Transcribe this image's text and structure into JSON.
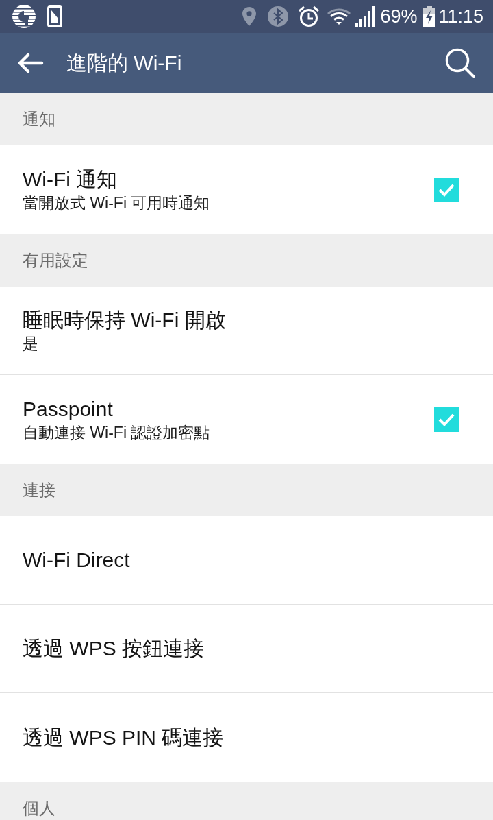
{
  "status_bar": {
    "battery": "69%",
    "time": "11:15"
  },
  "app_bar": {
    "title": "進階的 Wi-Fi"
  },
  "sections": [
    {
      "header": "通知",
      "items": [
        {
          "kind": "checkbox",
          "title": "Wi-Fi 通知",
          "subtitle": "當開放式 Wi-Fi 可用時通知",
          "checked": true
        }
      ]
    },
    {
      "header": "有用設定",
      "items": [
        {
          "kind": "plain",
          "title": "睡眠時保持 Wi-Fi 開啟",
          "subtitle": "是"
        },
        {
          "kind": "checkbox",
          "title": "Passpoint",
          "subtitle": "自動連接 Wi-Fi 認證加密點",
          "checked": true
        }
      ]
    },
    {
      "header": "連接",
      "items": [
        {
          "kind": "plain",
          "title": "Wi-Fi Direct"
        },
        {
          "kind": "plain",
          "title": "透過 WPS 按鈕連接"
        },
        {
          "kind": "plain",
          "title": "透過 WPS PIN 碼連接"
        }
      ]
    },
    {
      "header": "個人"
    }
  ]
}
